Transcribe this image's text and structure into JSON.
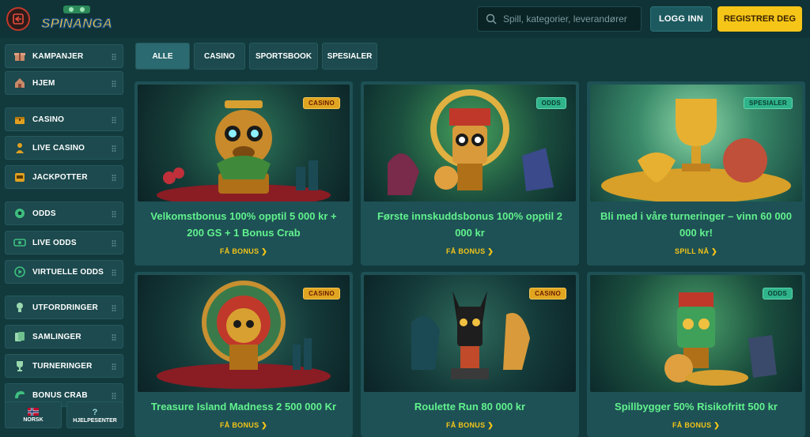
{
  "header": {
    "logo_text": "SPINANGA",
    "search_placeholder": "Spill, kategorier, leverandører",
    "login_label": "LOGG INN",
    "register_label": "REGISTRER DEG"
  },
  "sidebar": {
    "items": [
      {
        "label": "KAMPANJER",
        "icon": "gift-icon"
      },
      {
        "label": "HJEM",
        "icon": "home-icon"
      },
      {
        "label": "CASINO",
        "icon": "treasure-chest-icon"
      },
      {
        "label": "LIVE CASINO",
        "icon": "dealer-icon"
      },
      {
        "label": "JACKPOTTER",
        "icon": "slot-machine-icon"
      },
      {
        "label": "ODDS",
        "icon": "football-icon"
      },
      {
        "label": "LIVE ODDS",
        "icon": "live-odds-icon"
      },
      {
        "label": "VIRTUELLE ODDS",
        "icon": "play-circle-icon"
      },
      {
        "label": "UTFORDRINGER",
        "icon": "challenge-icon"
      },
      {
        "label": "SAMLINGER",
        "icon": "cards-icon"
      },
      {
        "label": "TURNERINGER",
        "icon": "trophy-icon"
      },
      {
        "label": "BONUS CRAB",
        "icon": "crab-claw-icon"
      }
    ],
    "language_label": "NORSK",
    "help_label": "HJELPESENTER"
  },
  "tabs": [
    {
      "label": "ALLE",
      "active": true
    },
    {
      "label": "CASINO",
      "active": false
    },
    {
      "label": "SPORTSBOOK",
      "active": false
    },
    {
      "label": "SPESIALER",
      "active": false
    }
  ],
  "promos": [
    {
      "badge": "CASINO",
      "badge_type": "casino",
      "title": "Velkomstbonus 100% opptil 5 000 kr + 200 GS + 1 Bonus Crab",
      "cta": "FÅ BONUS",
      "art": "monkey-idol"
    },
    {
      "badge": "ODDS",
      "badge_type": "odds",
      "title": "Første innskuddsbonus 100% opptil 2 000 kr",
      "cta": "FÅ BONUS",
      "art": "tiki-football"
    },
    {
      "badge": "SPESIALER",
      "badge_type": "spesialer",
      "title": "Bli med i våre turneringer – vinn 60 000 000 kr!",
      "cta": "SPILL NÅ",
      "art": "trophy-gold"
    },
    {
      "badge": "CASINO",
      "badge_type": "casino",
      "title": "Treasure Island Madness 2 500 000 Kr",
      "cta": "FÅ BONUS",
      "art": "roulette-idol"
    },
    {
      "badge": "CASINO",
      "badge_type": "casino",
      "title": "Roulette Run 80 000 kr",
      "cta": "FÅ BONUS",
      "art": "jackal-idol"
    },
    {
      "badge": "ODDS",
      "badge_type": "odds",
      "title": "Spillbygger 50% Risikofritt 500 kr",
      "cta": "FÅ BONUS",
      "art": "green-tiki"
    }
  ],
  "colors": {
    "background": "#123a3d",
    "card": "#1e5155",
    "title_green": "#61f28e",
    "accent_yellow": "#f5c518",
    "casino_badge": "#e0a520",
    "odds_badge": "#2fb38a"
  }
}
